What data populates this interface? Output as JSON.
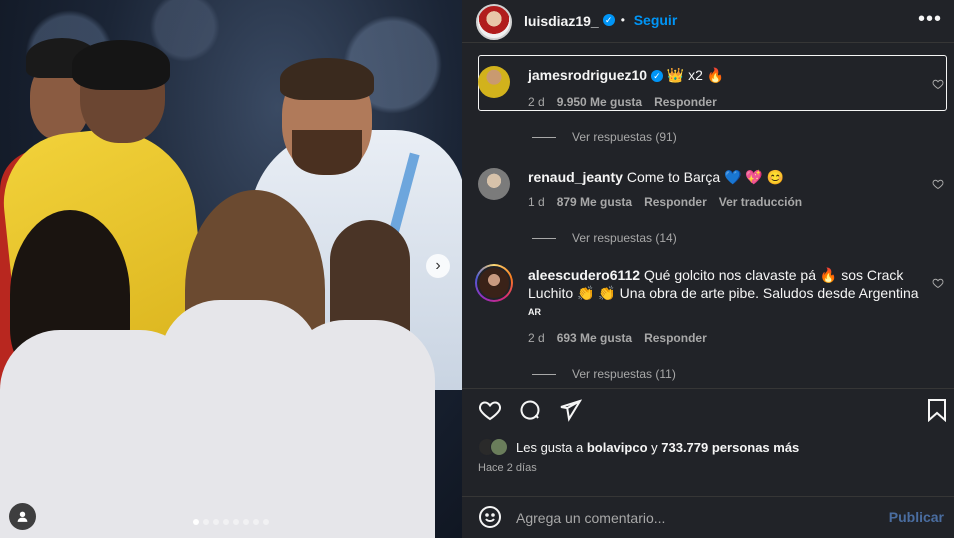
{
  "post": {
    "carousel_dots": 8,
    "carousel_active": 0
  },
  "header": {
    "username": "luisdiaz19_",
    "follow_label": "Seguir",
    "separator": "•"
  },
  "comments": [
    {
      "username": "jamesrodriguez10",
      "verified": true,
      "text": "👑 x2 🔥",
      "time": "2 d",
      "likes": "9.950 Me gusta",
      "reply_label": "Responder",
      "translate_label": "",
      "view_replies": "Ver respuestas (91)",
      "avatar_color": "#d2b21c"
    },
    {
      "username": "renaud_jeanty",
      "verified": false,
      "text": "Come to Barça 💙 💖 😊",
      "time": "1 d",
      "likes": "879 Me gusta",
      "reply_label": "Responder",
      "translate_label": "Ver traducción",
      "view_replies": "Ver respuestas (14)",
      "avatar_color": "#8c8c8c"
    },
    {
      "username": "aleescudero6112",
      "verified": false,
      "text": "Qué golcito nos clavaste pá 🔥 sos Crack Luchito 👏 👏 Una obra de arte pibe. Saludos desde Argentina",
      "tag": "AR",
      "time": "2 d",
      "likes": "693 Me gusta",
      "reply_label": "Responder",
      "translate_label": "",
      "view_replies": "Ver respuestas (11)",
      "avatar_color": "#6b3a2c"
    }
  ],
  "actions": {
    "like_icon": "heart-icon",
    "comment_icon": "comment-icon",
    "share_icon": "share-icon",
    "save_icon": "bookmark-icon"
  },
  "likes_line": {
    "prefix": "Les gusta a ",
    "user": "bolavipco",
    "middle": " y ",
    "count": "733.779 personas más"
  },
  "time_ago": "Hace 2 días",
  "add_comment": {
    "placeholder": "Agrega un comentario...",
    "post_label": "Publicar"
  },
  "colors": {
    "panel_bg": "#212328",
    "accent": "#0095f6",
    "muted": "#a8a8a8"
  }
}
